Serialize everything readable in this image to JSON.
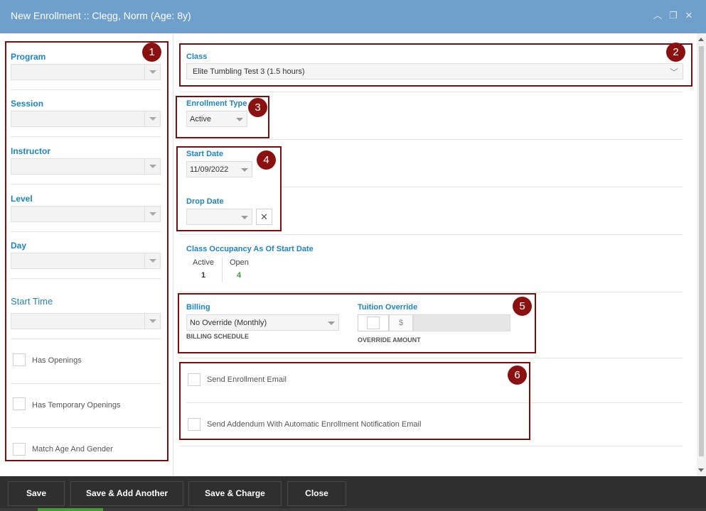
{
  "window": {
    "title": "New Enrollment :: Clegg, Norm (Age: 8y)",
    "controls": {
      "minimize": "︿",
      "restore": "❐",
      "close": "✕"
    }
  },
  "filters": {
    "program_label": "Program",
    "session_label": "Session",
    "instructor_label": "Instructor",
    "level_label": "Level",
    "day_label": "Day",
    "start_time_label": "Start Time",
    "has_openings_label": "Has Openings",
    "has_temp_openings_label": "Has Temporary Openings",
    "match_age_gender_label": "Match Age And Gender"
  },
  "form": {
    "class_label": "Class",
    "class_value": "Elite Tumbling Test 3 (1.5 hours)",
    "enrollment_type_label": "Enrollment Type",
    "enrollment_type_value": "Active",
    "start_date_label": "Start Date",
    "start_date_value": "11/09/2022",
    "drop_date_label": "Drop Date",
    "drop_date_value": "",
    "occupancy_label": "Class Occupancy As Of Start Date",
    "occupancy_active_label": "Active",
    "occupancy_active_value": "1",
    "occupancy_open_label": "Open",
    "occupancy_open_value": "4",
    "billing_label": "Billing",
    "billing_value": "No Override (Monthly)",
    "billing_sub": "BILLING SCHEDULE",
    "tuition_label": "Tuition Override",
    "tuition_currency": "$",
    "tuition_sub": "OVERRIDE AMOUNT",
    "send_email_label": "Send Enrollment Email",
    "send_addendum_label": "Send Addendum With Automatic Enrollment Notification Email"
  },
  "annotations": [
    "1",
    "2",
    "3",
    "4",
    "5",
    "6"
  ],
  "footer": {
    "save": "Save",
    "save_add": "Save & Add Another",
    "save_charge": "Save & Charge",
    "close": "Close"
  },
  "colors": {
    "titlebar": "#6f9fcb",
    "accent": "#1d84bf",
    "annotation": "#8b1010",
    "open_count": "#3a9a3a",
    "footer": "#2f2f2f"
  }
}
